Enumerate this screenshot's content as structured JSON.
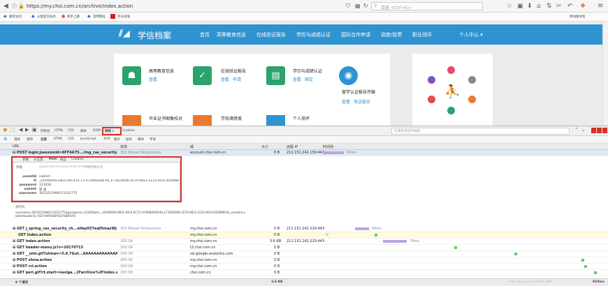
{
  "browser": {
    "url": "https://my.chsi.com.cn/archive/index.action",
    "search_placeholder": "百度 <Ctrl+K>",
    "bookmarks": [
      "最常访问",
      "火狐官方站点",
      "新手上路",
      "常用网址",
      "京东商城"
    ],
    "right_bookmark": "移动版书签"
  },
  "site": {
    "logo": "学信档案",
    "nav": [
      "首页",
      "高等教育信息",
      "在线验证报告",
      "学历与成绩认证",
      "国际合作申请",
      "调查/投票",
      "职业测评",
      "个人中心 ▾"
    ],
    "cards": [
      {
        "title": "高等教育信息",
        "link1": "查看"
      },
      {
        "title": "在线验证报告",
        "link1": "查看",
        "link2": "申请"
      },
      {
        "title": "学历与成绩认证",
        "link1": "查看",
        "link2": "绑定"
      },
      {
        "title": "留学认证报告传输",
        "link1": "查看",
        "link2": "发送报告"
      },
      {
        "title": "毕业证书图像校对"
      },
      {
        "title": "学校满意度"
      },
      {
        "title": "个人测评"
      }
    ]
  },
  "devtools": {
    "tabs": [
      "控制台",
      "HTML",
      "CSS",
      "脚本",
      "DOM",
      "网络 ▾",
      "Cookies"
    ],
    "filters": [
      "清除",
      "保持",
      "全部",
      "HTML",
      "CSS",
      "JavaScript",
      "XHR",
      "图片",
      "插件",
      "媒体",
      "字体"
    ],
    "search_placeholder": "在请求/响应中搜索",
    "columns": [
      "URL",
      "状态",
      "域",
      "大小",
      "远程 IP",
      "时间线"
    ],
    "sel_req": {
      "url": "⊟ POST login;jsessionid=6FF4A75...ring_cas_security_c",
      "status": "302 Moved Temporarily",
      "domain": "account.chsi.com.cn",
      "size": "0 B",
      "ip": "211.151.242.150:443",
      "time": "43ms"
    },
    "panel_tabs": [
      "参数",
      "头信息",
      "Post",
      "响应",
      "Cookies"
    ],
    "param_hdr": "参数",
    "param_type": "application/x-www-form-urlencoded",
    "param_sort": "不按字母排序",
    "params": [
      {
        "k": "_eventId",
        "v": "submit"
      },
      {
        "k": "lt",
        "v": "_c05A6956-E9E0-39C9-EC73-47369E956F06_k7362D006-3579-0813-3233-953CA0589B03"
      },
      {
        "k": "password",
        "v": "123456"
      },
      {
        "k": "submit",
        "v": "登 录"
      },
      {
        "k": "username",
        "v": "3621011998111031775"
      }
    ],
    "source_label": "源代码",
    "source_text": "username=3621011998111031775&password=123456&lt=_c05A6956-E9E0-39C9-EC73-47369E956F06_k7362D006-3579-0813-3233-953CA0589B03&_eventId=submit&submit=%E7%99%BB%E5%BD%95",
    "rows": [
      {
        "url": "⊞ GET j_spring_cas_security_ch...eHay037eqfXmayWj",
        "status": "302 Moved Temporarily",
        "domain": "my.chsi.com.cn",
        "size": "0 B",
        "ip": "211.151.242.220:443",
        "time": "45ms"
      },
      {
        "url": "GET index.action",
        "status": "",
        "domain": "my.chsi.com.cn",
        "size": "0 B",
        "ip": "",
        "time": ""
      },
      {
        "url": "⊞ GET index.action",
        "status": "200 OK",
        "domain": "my.chsi.com.cn",
        "size": "3.6 KB",
        "ip": "211.151.242.220:443",
        "time": "79ms"
      },
      {
        "url": "⊞ GET header-menu.js?v=20170713",
        "status": "200 OK",
        "domain": "t2.chsi.com.cn",
        "size": "0 B",
        "ip": "",
        "time": ""
      },
      {
        "url": "⊞ GET __utm.gif?utmwv=5.6.7&ut...AAAAAAAAAAAAA&",
        "status": "200 OK",
        "domain": "ssl.google-analytics.com",
        "size": "0 B",
        "ip": "",
        "time": ""
      },
      {
        "url": "⊞ POST show.action",
        "status": "200 OK",
        "domain": "my.chsi.com.cn",
        "size": "0 B",
        "ip": "",
        "time": ""
      },
      {
        "url": "⊞ POST rcl.action",
        "status": "200 OK",
        "domain": "my.chsi.com.cn",
        "size": "0 B",
        "ip": "",
        "time": ""
      },
      {
        "url": "⊞ GET perl.gif?rt.start=naviga...2Farchive%2Findex.actio",
        "status": "200 OK",
        "domain": "chsi.com.cn",
        "size": "0 B",
        "ip": "",
        "time": ""
      }
    ],
    "footer_count": "8 个请求",
    "footer_size": "3.6 KB",
    "footer_time": "910ms",
    "watermark": "http://blog.csdn.net/XS_NM"
  }
}
